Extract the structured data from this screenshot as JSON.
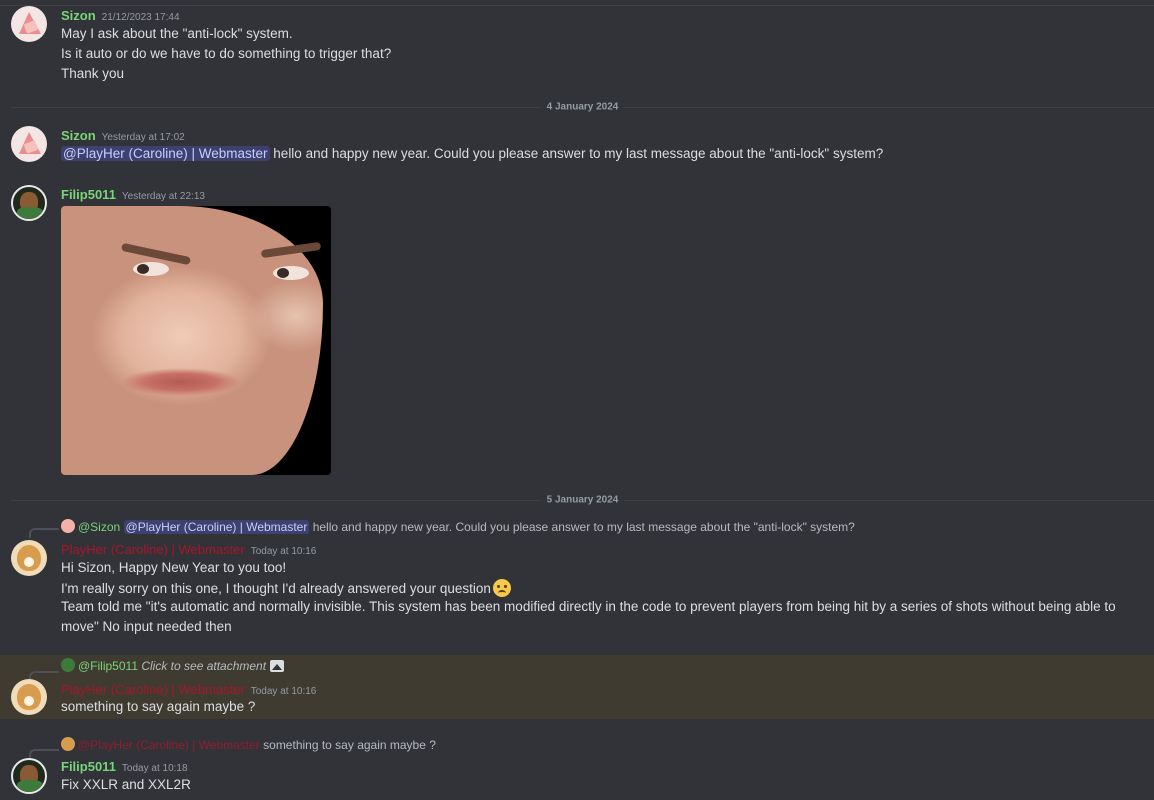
{
  "messages": {
    "m1": {
      "username": "Sizon",
      "timestamp": "21/12/2023 17:44",
      "lines": [
        "May I ask about the \"anti-lock\" system.",
        "Is it auto or do we have to do something to trigger that?",
        "Thank you"
      ]
    },
    "divider1": "4 January 2024",
    "m2": {
      "username": "Sizon",
      "timestamp": "Yesterday at 17:02",
      "mention": "@PlayHer (Caroline) | Webmaster",
      "text": "hello and happy new year. Could you please answer to my last message about the \"anti-lock\" system?"
    },
    "m3": {
      "username": "Filip5011",
      "timestamp": "Yesterday at 22:13"
    },
    "divider2": "5 January 2024",
    "m4": {
      "reply_name": "@Sizon",
      "reply_mention": "@PlayHer (Caroline) | Webmaster",
      "reply_text": "hello and happy new year. Could you please answer to my last message about the \"anti-lock\" system?",
      "username": "PlayHer (Caroline) | Webmaster",
      "timestamp": "Today at 10:16",
      "line1": "Hi Sizon, Happy New Year to you too!",
      "line2": "I'm really sorry on this one, I thought I'd already answered your question",
      "line3": "Team told me \"it's automatic and normally invisible. This system has been modified directly in the code to prevent players from being hit by a series of shots without being able to",
      "line4": "move\" No input needed then"
    },
    "m5": {
      "reply_name": "@Filip5011",
      "reply_text": "Click to see attachment",
      "username": "PlayHer (Caroline) | Webmaster",
      "timestamp": "Today at 10:16",
      "text": "something to say again maybe ?"
    },
    "m6": {
      "reply_name": "@PlayHer (Caroline) | Webmaster",
      "reply_text": "something to say again maybe ?",
      "username": "Filip5011",
      "timestamp": "Today at 10:18",
      "text": "Fix XXLR and XXL2R"
    }
  },
  "colors": {
    "background": "#313338",
    "username_green": "#79d47a",
    "username_red": "#a8162a",
    "mention_bg": "#5865f2",
    "highlight_bg": "#3f3b31"
  }
}
